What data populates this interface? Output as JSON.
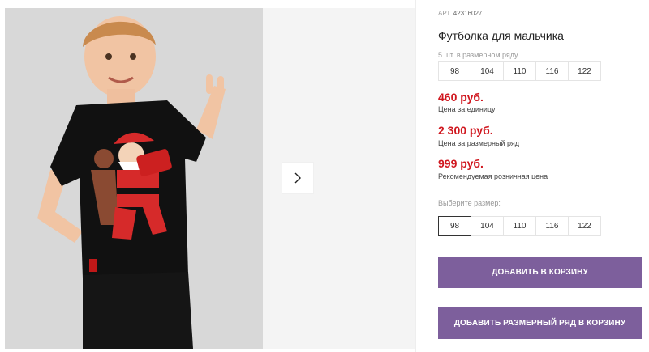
{
  "product": {
    "sku_label": "АРТ.",
    "sku_value": "42316027",
    "title": "Футболка для мальчика",
    "pack_note": "5 шт. в размерном ряду",
    "pack_sizes": [
      "98",
      "104",
      "110",
      "116",
      "122"
    ],
    "prices": [
      {
        "value": "460 руб.",
        "label": "Цена за единицу"
      },
      {
        "value": "2 300 руб.",
        "label": "Цена за размерный ряд"
      },
      {
        "value": "999 руб.",
        "label": "Рекомендуемая розничная цена"
      }
    ],
    "choose_size_label": "Выберите размер:",
    "sizes": [
      "98",
      "104",
      "110",
      "116",
      "122"
    ],
    "selected_size": "98"
  },
  "actions": {
    "add_to_cart": "ДОБАВИТЬ В КОРЗИНУ",
    "add_pack_to_cart": "ДОБАВИТЬ РАЗМЕРНЫЙ РЯД В КОРЗИНУ"
  },
  "gallery": {
    "next_icon": "chevron-right-icon"
  },
  "colors": {
    "accent": "#7d5f9c",
    "price": "#d0171f"
  }
}
